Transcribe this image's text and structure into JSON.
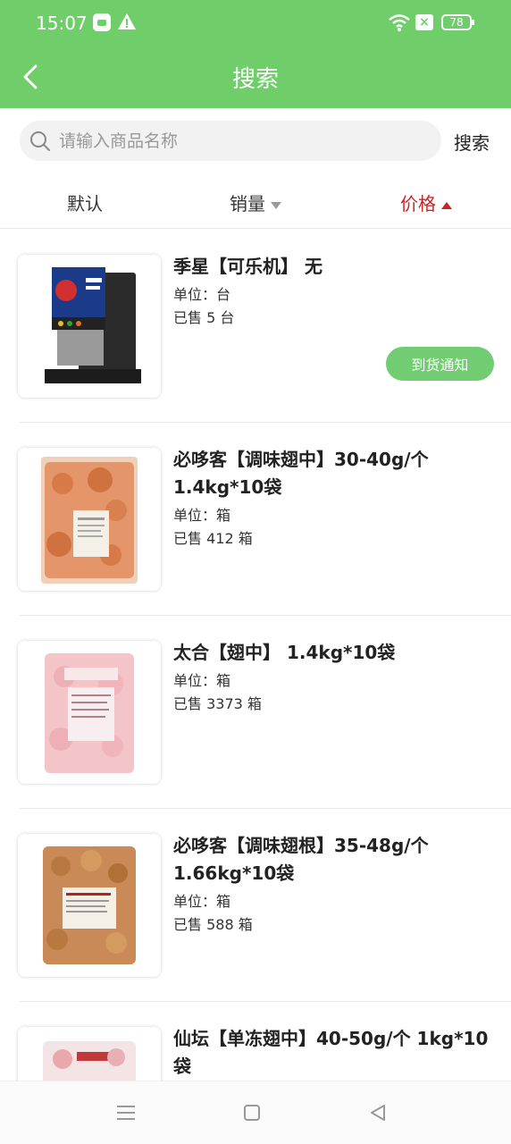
{
  "status_bar": {
    "time": "15:07",
    "battery": "78",
    "icons": [
      "app-notification-icon",
      "warning-icon",
      "wifi-icon",
      "sim-off-icon",
      "battery-icon"
    ]
  },
  "header": {
    "title": "搜索",
    "background": "#6fce6a"
  },
  "search": {
    "placeholder": "请输入商品名称",
    "value": "",
    "button_label": "搜索"
  },
  "sort_tabs": [
    {
      "label": "默认",
      "active": false
    },
    {
      "label": "销量",
      "direction": "down",
      "active": false
    },
    {
      "label": "价格",
      "direction": "up",
      "active": true,
      "color": "#cc2222"
    }
  ],
  "products": [
    {
      "name": "季星【可乐机】 无",
      "unit": "单位：台",
      "sold": "已售 5 台",
      "action": "到货通知",
      "image": "cola-machine"
    },
    {
      "name": "必哆客【调味翅中】30-40g/个 1.4kg*10袋",
      "unit": "单位：箱",
      "sold": "已售 412 箱",
      "image": "seasoned-wings-bag"
    },
    {
      "name": "太合【翅中】 1.4kg*10袋",
      "unit": "单位：箱",
      "sold": "已售 3373 箱",
      "image": "raw-wings-bag"
    },
    {
      "name": "必哆客【调味翅根】35-48g/个 1.66kg*10袋",
      "unit": "单位：箱",
      "sold": "已售 588 箱",
      "image": "seasoned-drumettes-bag"
    },
    {
      "name": "仙坛【单冻翅中】40-50g/个 1kg*10袋",
      "unit": "",
      "sold": "",
      "image": "frozen-wings-bag"
    }
  ],
  "accent_button_color": "#72cc72",
  "nav_bar": {
    "icons": [
      "menu-icon",
      "home-icon",
      "back-icon"
    ]
  }
}
